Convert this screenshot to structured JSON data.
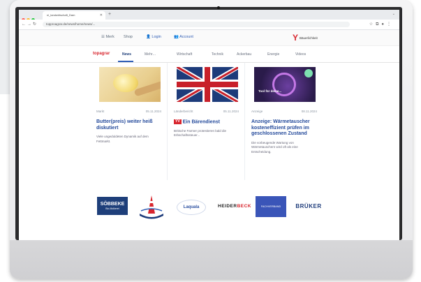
{
  "browser": {
    "tab_title": "ni_landwirtschaft_Dam",
    "url": "topproagrar.de/news/home/news/..."
  },
  "site_top": {
    "links": [
      "Merk",
      "Shop",
      "Login",
      "Account"
    ],
    "brand_text": "Bäuerlichkeit"
  },
  "nav": {
    "logo": "topagrar",
    "items": [
      "News",
      "Mehr…",
      "Wirtschaft",
      "Technik",
      "Ackerbau",
      "Energie",
      "Videos"
    ]
  },
  "cards": [
    {
      "category": "Markt",
      "date": "05.11.2024",
      "title": "Butter(preis) weiter heiß diskutiert",
      "text": "Viele ungeduldeten Dynamik auf dem Fettmarkt.",
      "image": "butter"
    },
    {
      "category": "Länderbericht",
      "date": "05.11.2024",
      "badge": "YV",
      "title": "Ein Bärendienst",
      "text": "Britische Farmer protestieren bald die Erbschaftssteuer...",
      "image": "uk-flag"
    },
    {
      "category": "Anzeige",
      "date": "08.11.2024",
      "title": "Anzeige: Wärmetauscher kosteneffizient prüfen im geschlossenen Zustand",
      "text": "Die vorbeugende Wartung von Wärmetauschern wird oft als eine Entscheidung.",
      "image": "ad",
      "image_caption": "Tool für deine..."
    }
  ],
  "logos": {
    "sobbeke_a": "SÖBBEKE",
    "sobbeke_b": "Bio-Molkerei",
    "ammerland": "Ammerländer",
    "laquala": "Laquala",
    "heider": "HEIDER",
    "heider_b": "BECK",
    "fachverband": "FACHVERBAND",
    "bruker": "BRÜKER"
  },
  "colors": {
    "brand_red": "#d8262e",
    "link_blue": "#244a9b"
  }
}
